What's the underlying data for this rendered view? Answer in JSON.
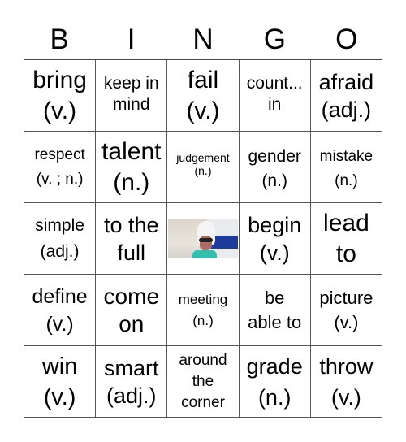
{
  "header": {
    "letters": [
      "B",
      "I",
      "N",
      "G",
      "O"
    ]
  },
  "board": {
    "rows": [
      [
        {
          "text": "bring\n(v.)"
        },
        {
          "text": "keep in\nmind"
        },
        {
          "text": "fail\n(v.)"
        },
        {
          "text": "count...\nin"
        },
        {
          "text": "afraid\n(adj.)"
        }
      ],
      [
        {
          "text": "respect\n(v. ; n.)"
        },
        {
          "text": "talent\n(n.)"
        },
        {
          "text": "judgement\n(n.)"
        },
        {
          "text": "gender\n(n.)"
        },
        {
          "text": "mistake\n(n.)"
        }
      ],
      [
        {
          "text": "simple\n(adj.)"
        },
        {
          "text": "to the\nfull"
        },
        {
          "text": "",
          "image": "free-space-photo"
        },
        {
          "text": "begin\n(v.)"
        },
        {
          "text": "lead\nto"
        }
      ],
      [
        {
          "text": "define\n(v.)"
        },
        {
          "text": "come\non"
        },
        {
          "text": "meeting\n(n.)"
        },
        {
          "text": "be\nable to"
        },
        {
          "text": "picture\n(v.)"
        }
      ],
      [
        {
          "text": "win\n(v.)"
        },
        {
          "text": "smart\n(adj.)"
        },
        {
          "text": "around\nthe\ncorner"
        },
        {
          "text": "grade\n(n.)"
        },
        {
          "text": "throw\n(v.)"
        }
      ]
    ]
  }
}
